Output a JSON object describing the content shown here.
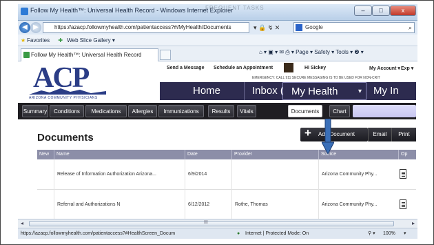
{
  "window": {
    "title": "Follow My Health™: Universal Health Record - Windows Internet Explorer",
    "ghost_text": "FREQUENT TASKS",
    "minimize": "–",
    "maximize": "□",
    "close": "x"
  },
  "browser": {
    "back": "◀",
    "forward": "▶",
    "address": "https://azacp.followmyhealth.com/patientaccess?#/MyHealth/Documents",
    "addr_tools": "▾ 🔒 ↯ ✕",
    "search_placeholder": "Google",
    "search_icon": "⌕",
    "favorites_label": "Favorites",
    "web_slice": "Web Slice Gallery ▾",
    "tab_title": "Follow My Health™: Universal Health Record",
    "command_bar": "⌂ ▾  ▣ ▾  ✉  ⎙ ▾  Page ▾  Safety ▾  Tools ▾  ❷ ▾"
  },
  "site": {
    "logo_text": "ACP",
    "logo_sub": "ARIZONA COMMUNITY PHYSICIANS",
    "top_links": {
      "send_message": "Send a Message",
      "schedule": "Schedule an Appointment",
      "user": "Hi Sickey",
      "my_account": "My Account ▾",
      "exp": "Exp ▾"
    },
    "emergency": "EMERGENCY: CALL 911   SECURE MESSAGING IS TO BE USED FOR NON-CRIT",
    "big_nav": {
      "home": "Home",
      "inbox": "Inbox (8)",
      "my_health": "My Health",
      "my_health_caret": "▾",
      "my_i": "My In"
    },
    "sub_tabs": [
      "Summary",
      "Conditions",
      "Medications",
      "Allergies",
      "Immunizations",
      "Results",
      "Vitals",
      "Documents",
      "Chart"
    ],
    "active_sub_tab": "Documents"
  },
  "documents": {
    "title": "Documents",
    "add_button": "Add Document",
    "email_button": "Email",
    "print_button": "Print",
    "columns": [
      "New",
      "Name",
      "Date",
      "Provider",
      "Source",
      "Op"
    ],
    "rows": [
      {
        "name": "Release of Information Authorization Arizona...",
        "date": "6/9/2014",
        "provider": "",
        "source": "Arizona Community Phy..."
      },
      {
        "name": "Referral and Authorizations N",
        "date": "6/12/2012",
        "provider": "Rothe, Thomas",
        "source": "Arizona Community Phy..."
      }
    ]
  },
  "statusbar": {
    "url": "https://azacp.followmyhealth.com/patientaccess?#HealthScreen_Docum",
    "zone": "Internet | Protected Mode: On",
    "zoom": "100%",
    "scroll_mark": "III"
  },
  "colors": {
    "nav_dark": "#2d2b4f",
    "logo_blue": "#2b3d86",
    "arrow_blue": "#3a6fb8",
    "table_header": "#8c8ea8"
  }
}
